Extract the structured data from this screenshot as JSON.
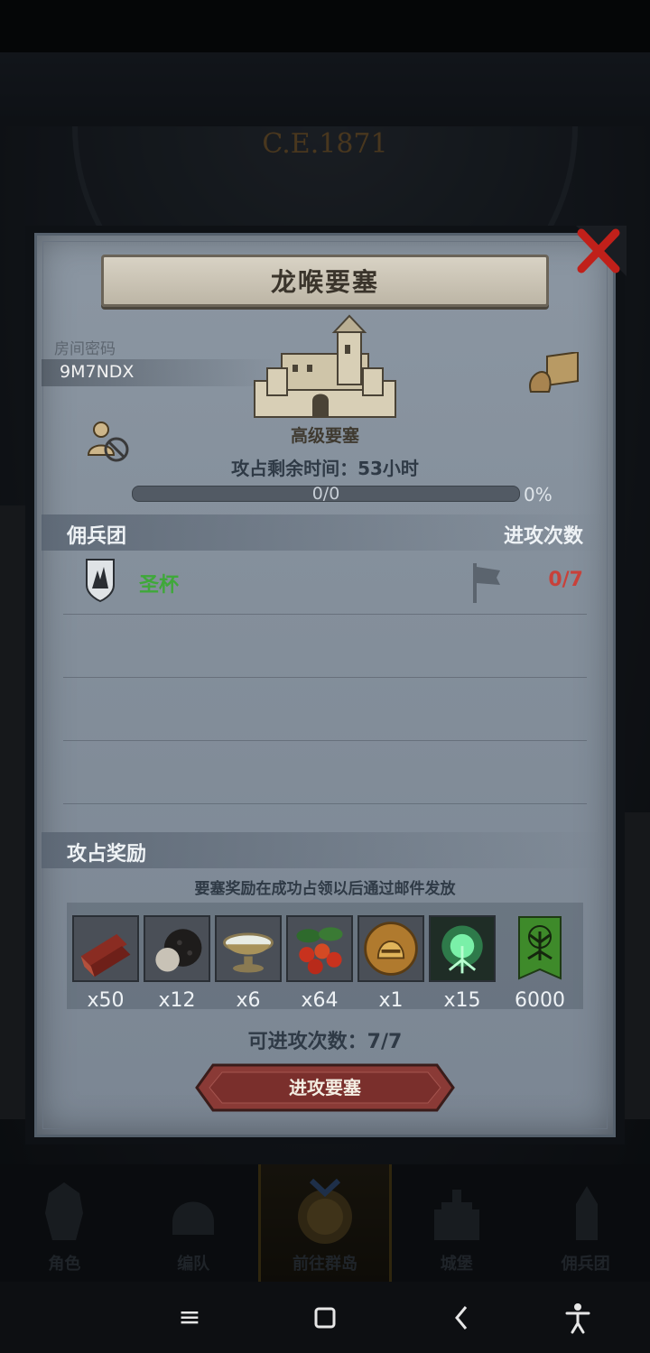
{
  "scene": {
    "era_label": "C.E.1871"
  },
  "dialog": {
    "title": "龙喉要塞",
    "room_code_label": "房间密码",
    "room_code": "9M7NDX",
    "castle_type": "高级要塞",
    "time_remaining": "攻占剩余时间：53小时",
    "progress_count": "0/0",
    "progress_percent": "0%",
    "progress_value": 0,
    "mercenary_header": "佣兵团",
    "attacks_header": "进攻次数",
    "mercenaries": [
      {
        "name": "圣杯",
        "attacks": "0/7"
      }
    ],
    "rewards_header": "攻占奖励",
    "rewards_note": "要塞奖励在成功占领以后通过邮件发放",
    "rewards": [
      {
        "icon": "wood-planks-icon",
        "qty": "x50"
      },
      {
        "icon": "truffle-icon",
        "qty": "x12"
      },
      {
        "icon": "milk-bowl-icon",
        "qty": "x6"
      },
      {
        "icon": "berries-icon",
        "qty": "x64"
      },
      {
        "icon": "knight-helmet-coin-icon",
        "qty": "x1"
      },
      {
        "icon": "green-tree-spirit-icon",
        "qty": "x15"
      },
      {
        "icon": "guild-banner-icon",
        "qty": "6000"
      }
    ],
    "attempts_label": "可进攻次数：7/7",
    "attack_button": "进攻要塞"
  },
  "bottom_nav": [
    {
      "label": "角色",
      "icon": "armor-icon"
    },
    {
      "label": "编队",
      "icon": "helmet-icon"
    },
    {
      "label": "前往群岛",
      "icon": "islands-icon",
      "active": true
    },
    {
      "label": "城堡",
      "icon": "castle-icon"
    },
    {
      "label": "佣兵团",
      "icon": "mercenary-icon"
    }
  ],
  "system_bar": {
    "menu": "≡",
    "home": "□",
    "back": "‹",
    "accessibility": "accessibility-icon"
  },
  "colors": {
    "mercenary_name": "#3fa83a",
    "attacks": "#c8413a",
    "close": "#c0201a"
  }
}
